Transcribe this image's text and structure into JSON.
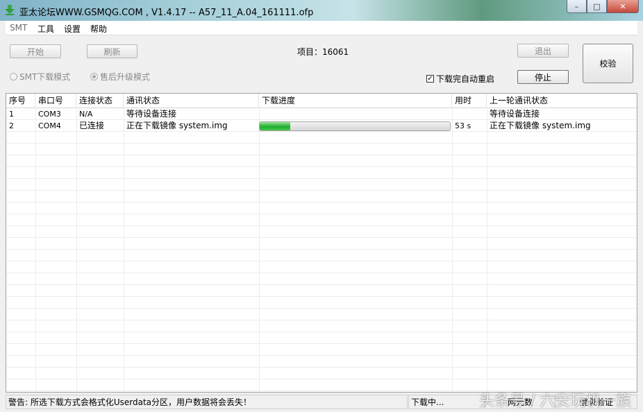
{
  "window": {
    "title": "亚太论坛WWW.GSMQG.COM    , V1.4.17 -- A57_11_A.04_161111.ofp"
  },
  "menu": [
    "SMT",
    "工具",
    "设置",
    "帮助"
  ],
  "toolbar": {
    "start_label": "开始",
    "refresh_label": "刷新",
    "project_label": "项目：16061",
    "exit_label": "退出",
    "verify_label": "校验",
    "stop_label": "停止",
    "auto_restart_label": "下载完自动重启",
    "auto_restart_checked": true,
    "mode_smt_label": "SMT下载模式",
    "mode_aftersale_label": "售后升级模式",
    "selected_mode": "aftersale"
  },
  "table": {
    "columns": [
      "序号",
      "串口号",
      "连接状态",
      "通讯状态",
      "下载进度",
      "用时",
      "上一轮通讯状态"
    ],
    "rows": [
      {
        "index": "1",
        "port": "COM3",
        "connection": "N/A",
        "comm": "等待设备连接",
        "progress": null,
        "time": "",
        "last": "等待设备连接"
      },
      {
        "index": "2",
        "port": "COM4",
        "connection": "已连接",
        "comm": "正在下载镜像 system.img",
        "progress": 16,
        "time": "53 s",
        "last": "正在下载镜像 system.img"
      }
    ]
  },
  "status": {
    "warning": "警告: 所选下载方式会格式化Userdata分区，用户数据将会丢失！",
    "state": "下载中...",
    "net": "网元数",
    "auth": "登录验证"
  },
  "watermark": "头条号 / 六安玩机一族",
  "colors": {
    "progress": "#1fae2e"
  }
}
